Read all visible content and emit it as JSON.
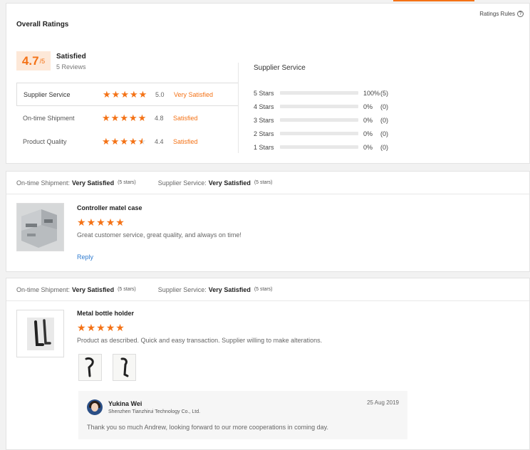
{
  "overall": {
    "title": "Overall Ratings",
    "rules_label": "Ratings Rules",
    "score": "4.7",
    "score_max": "/5",
    "satisfaction": "Satisfied",
    "reviews_count": "5 Reviews",
    "metrics": [
      {
        "label": "Supplier Service",
        "score": "5.0",
        "desc": "Very Satisfied",
        "stars": 5.0
      },
      {
        "label": "On-time Shipment",
        "score": "4.8",
        "desc": "Satisfied",
        "stars": 4.8
      },
      {
        "label": "Product Quality",
        "score": "4.4",
        "desc": "Satisfied",
        "stars": 4.4
      }
    ],
    "supplier_service_title": "Supplier Service",
    "distribution": [
      {
        "label": "5 Stars",
        "pct": "100%",
        "count": "(5)",
        "fraction": 1.0
      },
      {
        "label": "4 Stars",
        "pct": "0%",
        "count": "(0)",
        "fraction": 0
      },
      {
        "label": "3 Stars",
        "pct": "0%",
        "count": "(0)",
        "fraction": 0
      },
      {
        "label": "2 Stars",
        "pct": "0%",
        "count": "(0)",
        "fraction": 0
      },
      {
        "label": "1 Stars",
        "pct": "0%",
        "count": "(0)",
        "fraction": 0
      }
    ]
  },
  "reviews": [
    {
      "shipment_label": "On-time Shipment:",
      "shipment_value": "Very Satisfied",
      "shipment_stars": "(5 stars)",
      "service_label": "Supplier Service:",
      "service_value": "Very Satisfied",
      "service_stars": "(5 stars)",
      "product": "Controller matel case",
      "text": "Great customer service, great quality, and always on time!",
      "reply_label": "Reply"
    },
    {
      "shipment_label": "On-time Shipment:",
      "shipment_value": "Very Satisfied",
      "shipment_stars": "(5 stars)",
      "service_label": "Supplier Service:",
      "service_value": "Very Satisfied",
      "service_stars": "(5 stars)",
      "product": "Metal bottle holder",
      "text": "Product as described. Quick and easy transaction. Supplier willing to make alterations.",
      "reply": {
        "name": "Yukina Wei",
        "company": "Shenzhen Tianzhirui Technology Co., Ltd.",
        "date": "25 Aug 2019",
        "text": "Thank you so much Andrew, looking forward to our more cooperations in coming day."
      }
    }
  ],
  "colors": {
    "accent": "#f47216",
    "link": "#2f7bd0"
  }
}
